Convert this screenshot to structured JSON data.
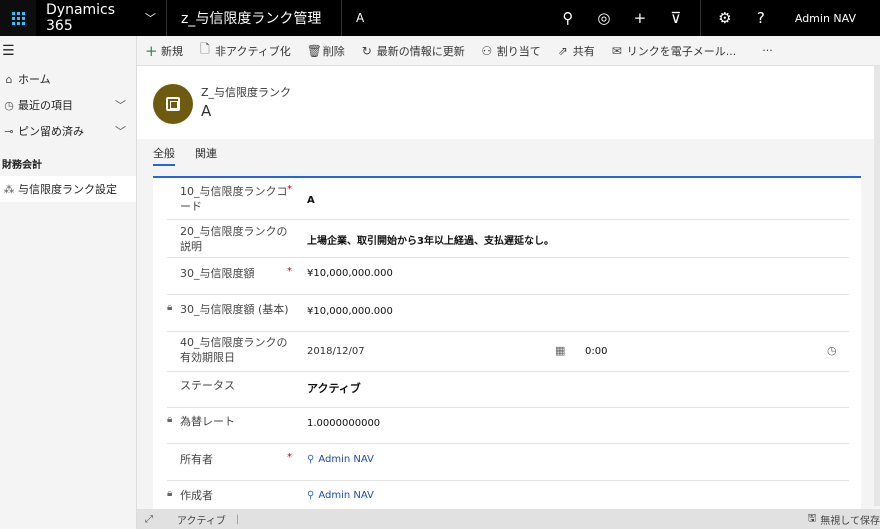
{
  "topbar": {
    "app_name": "Dynamics 365",
    "entity_title": "z_与信限度ランク管理",
    "record_name": "A",
    "user": "Admin NAV",
    "icons": [
      "waffle-icon",
      "search-icon",
      "task-icon",
      "plus-icon",
      "filter-icon",
      "gear-icon",
      "help-icon"
    ]
  },
  "commands": [
    {
      "icon": "plus-icon",
      "label": "新規"
    },
    {
      "icon": "deactivate-icon",
      "label": "非アクティブ化"
    },
    {
      "icon": "delete-icon",
      "label": "削除"
    },
    {
      "icon": "refresh-icon",
      "label": "最新の情報に更新"
    },
    {
      "icon": "assign-icon",
      "label": "割り当て"
    },
    {
      "icon": "share-icon",
      "label": "共有"
    },
    {
      "icon": "email-link-icon",
      "label": "リンクを電子メール..."
    },
    {
      "icon": "more-icon",
      "label": "···"
    }
  ],
  "sitemap": {
    "items": [
      {
        "icon": "home-icon",
        "label": "ホーム"
      },
      {
        "icon": "recent-icon",
        "label": "最近の項目"
      },
      {
        "icon": "pin-icon",
        "label": "ピン留め済み"
      }
    ],
    "group": "財務会計",
    "group_items": [
      {
        "icon": "puzzle-icon",
        "label": "与信限度ランク設定"
      }
    ]
  },
  "header": {
    "entity_label": "Z_与信限度ランク",
    "title": "A"
  },
  "tabs": [
    {
      "label": "全般",
      "active": true
    },
    {
      "label": "関連",
      "active": false
    }
  ],
  "fields": {
    "code": {
      "label": "10_与信限度ランクコード",
      "value": "A"
    },
    "desc": {
      "label": "20_与信限度ランクの説明",
      "value": "上場企業、取引開始から3年以上経過、支払遅延なし。"
    },
    "amount": {
      "label": "30_与信限度額",
      "value": "¥10,000,000.000"
    },
    "amount_base": {
      "label": "30_与信限度額 (基本)",
      "value": "¥10,000,000.000"
    },
    "expiry": {
      "label": "40_与信限度ランクの有効期限日",
      "date": "2018/12/07",
      "time": "0:00"
    },
    "status": {
      "label": "ステータス",
      "value": "アクティブ"
    },
    "rate": {
      "label": "為替レート",
      "value": "1.0000000000"
    },
    "owner": {
      "label": "所有者",
      "value": "Admin NAV"
    },
    "creator": {
      "label": "作成者",
      "value": "Admin NAV"
    }
  },
  "footer": {
    "status": "アクティブ",
    "save_label": "無視して保存"
  }
}
